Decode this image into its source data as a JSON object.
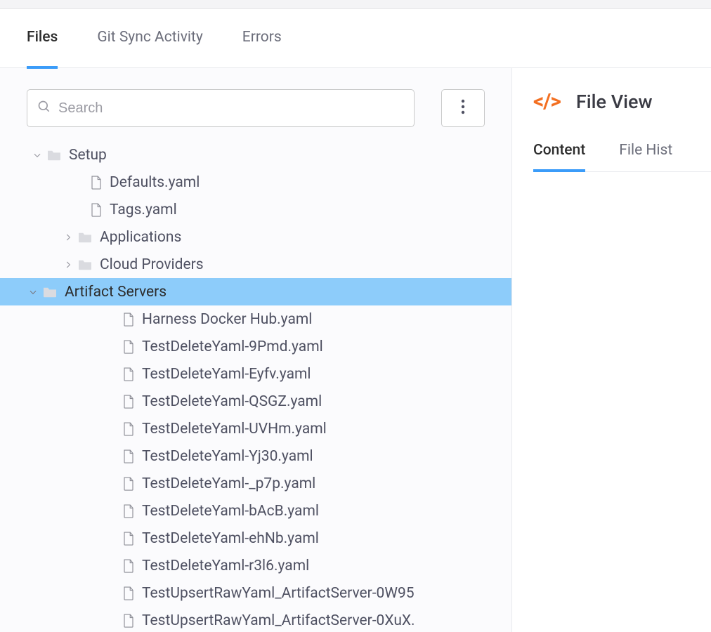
{
  "topTabs": {
    "files": "Files",
    "gitSync": "Git Sync Activity",
    "errors": "Errors"
  },
  "search": {
    "placeholder": "Search"
  },
  "tree": {
    "root": "Setup",
    "rootFiles": [
      "Defaults.yaml",
      "Tags.yaml"
    ],
    "folders": {
      "applications": "Applications",
      "cloudProviders": "Cloud Providers",
      "artifactServers": "Artifact Servers"
    },
    "artifactServerFiles": [
      "Harness Docker Hub.yaml",
      "TestDeleteYaml-9Pmd.yaml",
      "TestDeleteYaml-Eyfv.yaml",
      "TestDeleteYaml-QSGZ.yaml",
      "TestDeleteYaml-UVHm.yaml",
      "TestDeleteYaml-Yj30.yaml",
      "TestDeleteYaml-_p7p.yaml",
      "TestDeleteYaml-bAcB.yaml",
      "TestDeleteYaml-ehNb.yaml",
      "TestDeleteYaml-r3l6.yaml",
      "TestUpsertRawYaml_ArtifactServer-0W95",
      "TestUpsertRawYaml_ArtifactServer-0XuX."
    ]
  },
  "fileView": {
    "title": "File View",
    "tabs": {
      "content": "Content",
      "history": "File Hist"
    }
  }
}
